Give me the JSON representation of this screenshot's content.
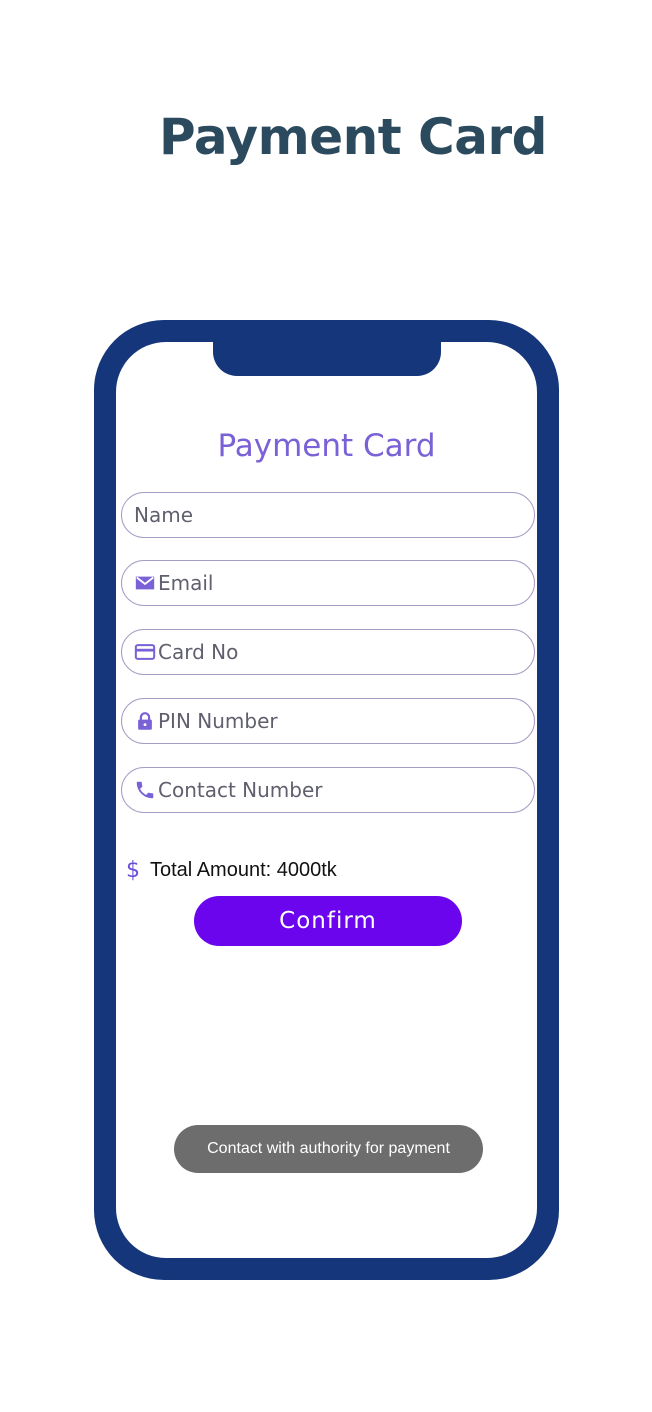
{
  "page": {
    "title": "Payment Card"
  },
  "app": {
    "title": "Payment Card",
    "fields": [
      {
        "placeholder": "Name",
        "icon": ""
      },
      {
        "placeholder": "Email",
        "icon": "mail-icon"
      },
      {
        "placeholder": "Card No",
        "icon": "credit-card-icon"
      },
      {
        "placeholder": "PIN Number",
        "icon": "lock-icon"
      },
      {
        "placeholder": "Contact Number",
        "icon": "phone-icon"
      }
    ],
    "total": {
      "icon": "dollar-icon",
      "label": "Total Amount: 4000tk"
    },
    "confirm_label": "Confirm",
    "toast": "Contact with authority for payment"
  },
  "colors": {
    "phone_frame": "#15367a",
    "accent": "#6a05ee",
    "icon": "#7a61d6",
    "page_title": "#2b4a5e",
    "toast_bg": "#6d6d6d"
  }
}
